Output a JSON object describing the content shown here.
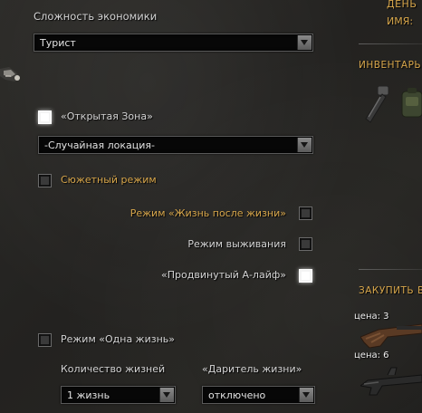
{
  "economy": {
    "label": "Сложность экономики",
    "value": "Турист"
  },
  "open_zone": {
    "label": "«Открытая Зона»",
    "location_value": "-Случайная локация-"
  },
  "story_mode": {
    "label": "Сюжетный режим"
  },
  "afterlife_mode": {
    "label": "Режим «Жизнь после жизни»"
  },
  "survival_mode": {
    "label": "Режим выживания"
  },
  "advanced_alife": {
    "label": "«Продвинутый А-лайф»"
  },
  "one_life": {
    "label": "Режим «Одна жизнь»",
    "lives_label": "Количество жизней",
    "lives_value": "1 жизнь",
    "giver_label": "«Даритель жизни»",
    "giver_value": "отключено"
  },
  "right_panel": {
    "money_label": "ДЕНЬ",
    "name_label": "ИМЯ:",
    "inventory_title": "ИНВЕНТАРЬ",
    "buy_title": "ЗАКУПИТЬ В",
    "price_1": "цена: 3",
    "price_2": "цена: 6"
  },
  "colors": {
    "accent_gold": "#d7a64b",
    "text": "#d4d4d4"
  }
}
